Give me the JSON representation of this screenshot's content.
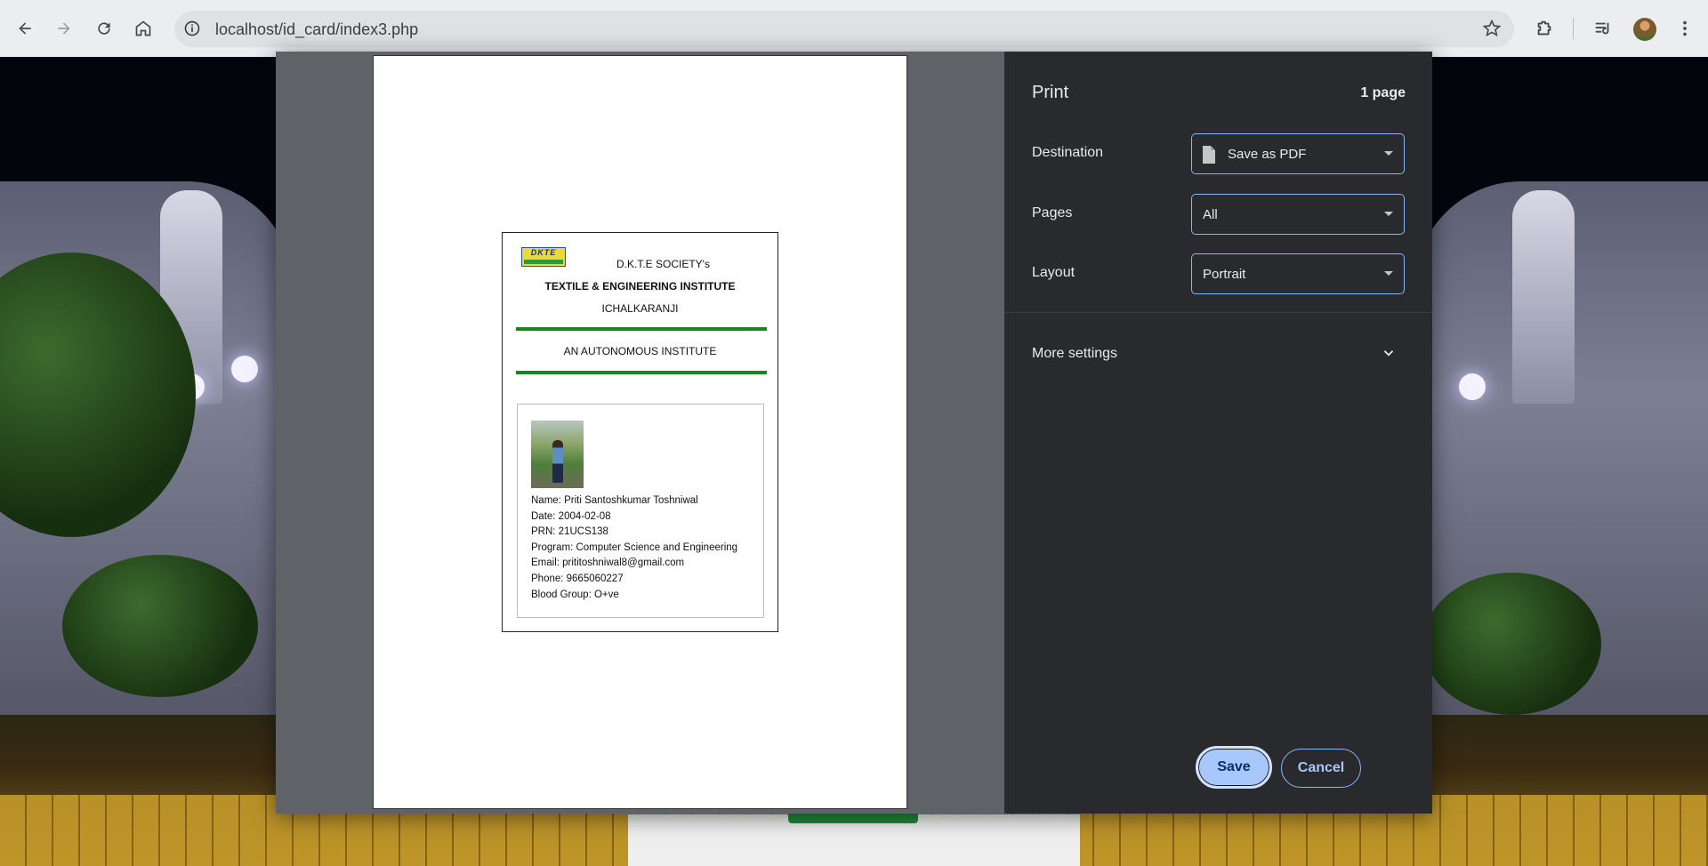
{
  "browser": {
    "url": "localhost/id_card/index3.php",
    "icons": [
      "back-icon",
      "forward-icon",
      "reload-icon",
      "home-icon",
      "site-info-icon",
      "bookmark-star-icon",
      "extensions-icon",
      "media-queue-icon",
      "profile-avatar",
      "kebab-menu-icon"
    ]
  },
  "print": {
    "title": "Print",
    "page_count": "1 page",
    "destination": {
      "label": "Destination",
      "value": "Save as PDF"
    },
    "pages": {
      "label": "Pages",
      "value": "All"
    },
    "layout": {
      "label": "Layout",
      "value": "Portrait"
    },
    "more_settings": "More settings",
    "save_label": "Save",
    "cancel_label": "Cancel"
  },
  "id_card": {
    "logo_text": "DKTE",
    "society": "D.K.T.E SOCIETY's",
    "institute": "TEXTILE & ENGINEERING INSTITUTE",
    "city": "ICHALKARANJI",
    "tagline": "AN AUTONOMOUS INSTITUTE",
    "fields": {
      "name": "Name: Priti Santoshkumar Toshniwal",
      "date": "Date: 2004-02-08",
      "prn": "PRN: 21UCS138",
      "program": "Program: Computer Science and Engineering",
      "email": "Email: prititoshniwal8@gmail.com",
      "phone": "Phone: 9665060227",
      "blood_group": "Blood Group: O+ve"
    }
  },
  "colors": {
    "dialog_bg": "#292a2d",
    "preview_bg": "#5f6368",
    "accent": "#8ab4f8",
    "save_button": "#a8c7fa",
    "card_rule": "#138a1c"
  }
}
